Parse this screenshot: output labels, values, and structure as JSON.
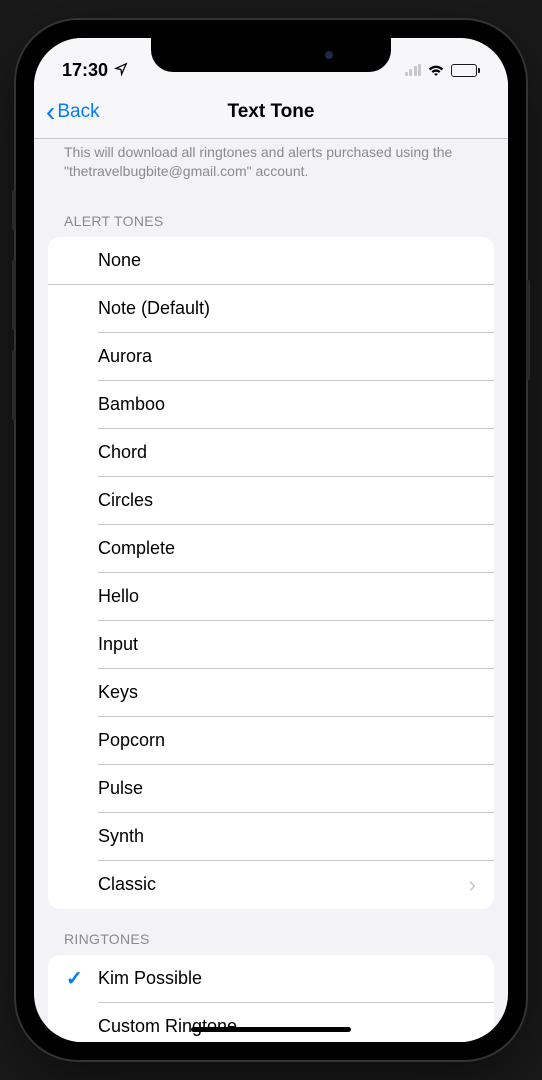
{
  "status": {
    "time": "17:30",
    "locationActive": true
  },
  "nav": {
    "backLabel": "Back",
    "title": "Text Tone"
  },
  "info": "This will download all ringtones and alerts purchased using the \"thetravelbugbite@gmail.com\" account.",
  "sections": {
    "alertTonesHeader": "ALERT TONES",
    "ringtonesHeader": "RINGTONES"
  },
  "alertTones": {
    "none": "None",
    "items": [
      {
        "label": "Note (Default)",
        "checked": false
      },
      {
        "label": "Aurora",
        "checked": false
      },
      {
        "label": "Bamboo",
        "checked": false
      },
      {
        "label": "Chord",
        "checked": false
      },
      {
        "label": "Circles",
        "checked": false
      },
      {
        "label": "Complete",
        "checked": false
      },
      {
        "label": "Hello",
        "checked": false
      },
      {
        "label": "Input",
        "checked": false
      },
      {
        "label": "Keys",
        "checked": false
      },
      {
        "label": "Popcorn",
        "checked": false
      },
      {
        "label": "Pulse",
        "checked": false
      },
      {
        "label": "Synth",
        "checked": false
      }
    ],
    "classic": "Classic"
  },
  "ringtones": {
    "items": [
      {
        "label": "Kim Possible",
        "checked": true
      },
      {
        "label": "Custom Ringtone",
        "checked": false
      }
    ]
  }
}
